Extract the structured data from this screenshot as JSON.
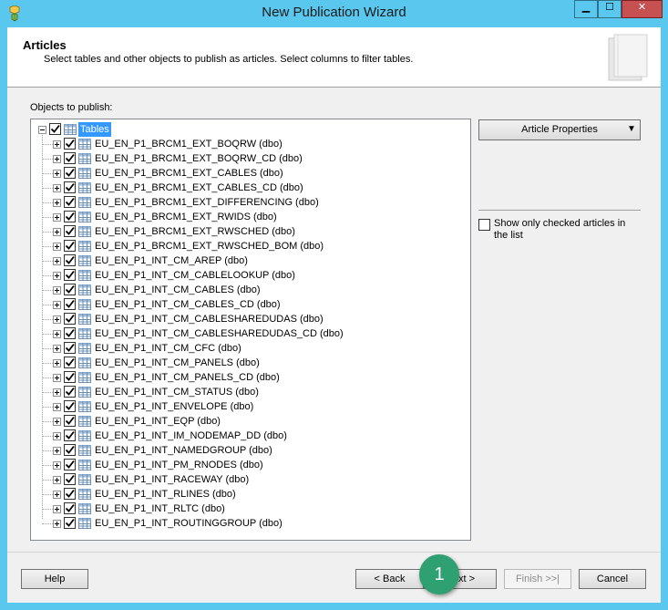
{
  "window": {
    "title": "New Publication Wizard"
  },
  "header": {
    "title": "Articles",
    "description": "Select tables and other objects to publish as articles. Select columns to filter tables."
  },
  "objects_label": "Objects to publish:",
  "tree": {
    "root_label": "Tables",
    "items": [
      "EU_EN_P1_BRCM1_EXT_BOQRW (dbo)",
      "EU_EN_P1_BRCM1_EXT_BOQRW_CD (dbo)",
      "EU_EN_P1_BRCM1_EXT_CABLES (dbo)",
      "EU_EN_P1_BRCM1_EXT_CABLES_CD (dbo)",
      "EU_EN_P1_BRCM1_EXT_DIFFERENCING (dbo)",
      "EU_EN_P1_BRCM1_EXT_RWIDS (dbo)",
      "EU_EN_P1_BRCM1_EXT_RWSCHED (dbo)",
      "EU_EN_P1_BRCM1_EXT_RWSCHED_BOM (dbo)",
      "EU_EN_P1_INT_CM_AREP (dbo)",
      "EU_EN_P1_INT_CM_CABLELOOKUP (dbo)",
      "EU_EN_P1_INT_CM_CABLES (dbo)",
      "EU_EN_P1_INT_CM_CABLES_CD (dbo)",
      "EU_EN_P1_INT_CM_CABLESHAREDUDAS (dbo)",
      "EU_EN_P1_INT_CM_CABLESHAREDUDAS_CD (dbo)",
      "EU_EN_P1_INT_CM_CFC (dbo)",
      "EU_EN_P1_INT_CM_PANELS (dbo)",
      "EU_EN_P1_INT_CM_PANELS_CD (dbo)",
      "EU_EN_P1_INT_CM_STATUS (dbo)",
      "EU_EN_P1_INT_ENVELOPE (dbo)",
      "EU_EN_P1_INT_EQP (dbo)",
      "EU_EN_P1_INT_IM_NODEMAP_DD (dbo)",
      "EU_EN_P1_INT_NAMEDGROUP (dbo)",
      "EU_EN_P1_INT_PM_RNODES (dbo)",
      "EU_EN_P1_INT_RACEWAY (dbo)",
      "EU_EN_P1_INT_RLINES (dbo)",
      "EU_EN_P1_INT_RLTC (dbo)",
      "EU_EN_P1_INT_ROUTINGGROUP (dbo)"
    ]
  },
  "side": {
    "article_properties_label": "Article Properties",
    "dropdown_arrow": "▼",
    "show_only_checked_label": "Show only checked articles in the list"
  },
  "buttons": {
    "help": "Help",
    "back": "< Back",
    "next": "Next >",
    "finish": "Finish >>|",
    "cancel": "Cancel"
  },
  "callout": {
    "number": "1"
  },
  "window_controls": {
    "minimize": "▁",
    "maximize": "☐",
    "close": "✕"
  },
  "colors": {
    "titlebar": "#5ac8ee",
    "selection": "#3399ff",
    "callout": "#2ea072"
  }
}
